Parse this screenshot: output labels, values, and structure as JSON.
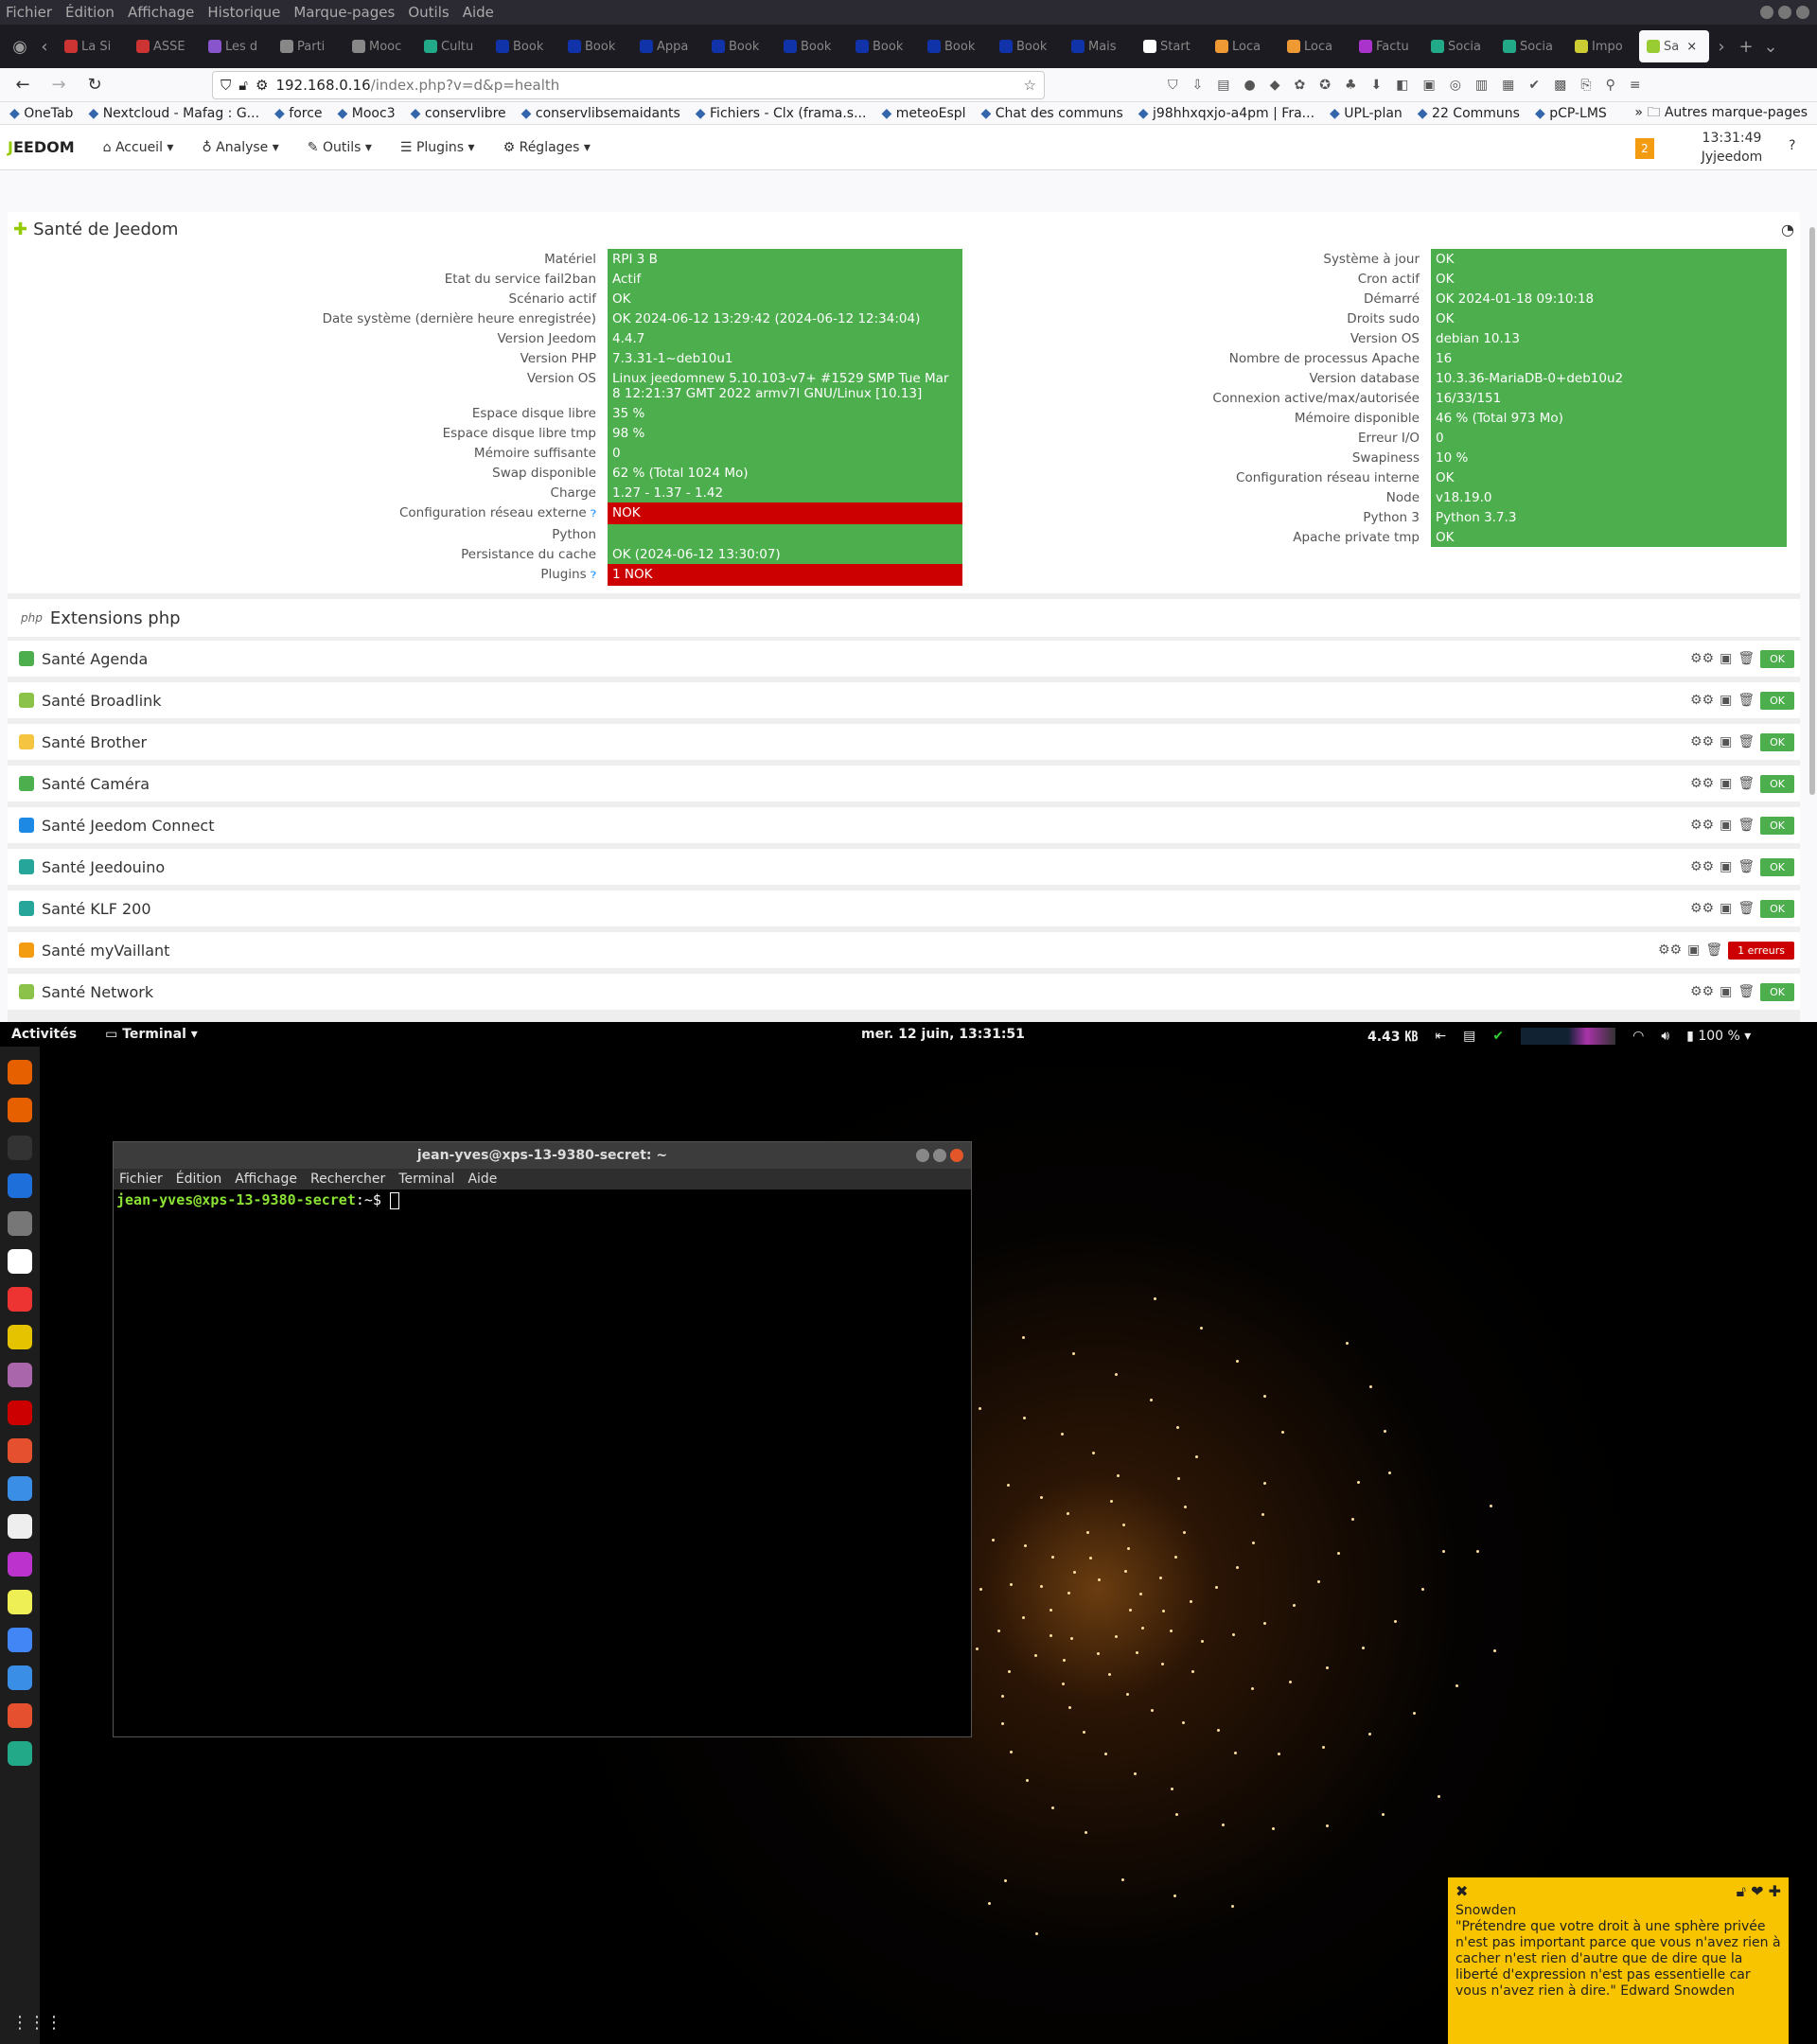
{
  "firefox": {
    "menu": [
      "Fichier",
      "Édition",
      "Affichage",
      "Historique",
      "Marque-pages",
      "Outils",
      "Aide"
    ],
    "tabs": [
      "La Si",
      "ASSE",
      "Les d",
      "Parti",
      "Mooc",
      "Cultu",
      "Book",
      "Book",
      "Appa",
      "Book",
      "Book",
      "Book",
      "Book",
      "Book",
      "Mais",
      "Start",
      "Loca",
      "Loca",
      "Factu",
      "Socia",
      "Socia",
      "Impo",
      "Sa"
    ],
    "url_host": "192.168.0.16",
    "url_path": "/index.php?v=d&p=health",
    "bookmarks": [
      "OneTab",
      "Nextcloud - Mafag : G...",
      "force",
      "Mooc3",
      "conservlibre",
      "conservlibsemaidants",
      "Fichiers - Clx (frama.s...",
      "meteoEspl",
      "Chat des communs",
      "j98hhxqxjo-a4pm | Fra...",
      "UPL-plan",
      "22 Communs",
      "pCP-LMS"
    ],
    "bookmarks_more": "Autres marque-pages"
  },
  "jeedom": {
    "logo_pre": "J",
    "logo_post": "EEDOM",
    "nav": [
      "Accueil",
      "Analyse",
      "Outils",
      "Plugins",
      "Réglages"
    ],
    "notif": "2",
    "time": "13:31:49",
    "user": "Jyjeedom",
    "health_title": "Santé de Jeedom",
    "left": [
      {
        "l": "Matériel",
        "v": "RPI 3 B",
        "s": "ok"
      },
      {
        "l": "Etat du service fail2ban",
        "v": "Actif",
        "s": "ok"
      },
      {
        "l": "Scénario actif",
        "v": "OK",
        "s": "ok"
      },
      {
        "l": "Date système (dernière heure enregistrée)",
        "v": "OK 2024-06-12 13:29:42 (2024-06-12 12:34:04)",
        "s": "ok"
      },
      {
        "l": "Version Jeedom",
        "v": "4.4.7",
        "s": "ok"
      },
      {
        "l": "Version PHP",
        "v": "7.3.31-1~deb10u1",
        "s": "ok"
      },
      {
        "l": "Version OS",
        "v": "Linux jeedomnew 5.10.103-v7+ #1529 SMP Tue Mar 8 12:21:37 GMT 2022 armv7l GNU/Linux [10.13]",
        "s": "ok"
      },
      {
        "l": "Espace disque libre",
        "v": "35 %",
        "s": "ok"
      },
      {
        "l": "Espace disque libre tmp",
        "v": "98 %",
        "s": "ok"
      },
      {
        "l": "Mémoire suffisante",
        "v": "0",
        "s": "ok"
      },
      {
        "l": "Swap disponible",
        "v": "62 % (Total 1024 Mo)",
        "s": "ok"
      },
      {
        "l": "Charge",
        "v": "1.27 - 1.37 - 1.42",
        "s": "ok"
      },
      {
        "l": "Configuration réseau externe",
        "v": "NOK",
        "s": "nok"
      },
      {
        "l": "Python",
        "v": "",
        "s": "ok"
      },
      {
        "l": "Persistance du cache",
        "v": "OK (2024-06-12 13:30:07)",
        "s": "ok"
      },
      {
        "l": "Plugins",
        "v": "1 NOK",
        "s": "nok"
      }
    ],
    "right": [
      {
        "l": "Système à jour",
        "v": "OK"
      },
      {
        "l": "Cron actif",
        "v": "OK"
      },
      {
        "l": "Démarré",
        "v": "OK 2024-01-18 09:10:18"
      },
      {
        "l": "Droits sudo",
        "v": "OK"
      },
      {
        "l": "Version OS",
        "v": "debian 10.13"
      },
      {
        "l": "Nombre de processus Apache",
        "v": "16"
      },
      {
        "l": "Version database",
        "v": "10.3.36-MariaDB-0+deb10u2"
      },
      {
        "l": "Connexion active/max/autorisée",
        "v": "16/33/151"
      },
      {
        "l": "Mémoire disponible",
        "v": "46 % (Total 973 Mo)"
      },
      {
        "l": "Erreur I/O",
        "v": "0"
      },
      {
        "l": "Swapiness",
        "v": "10 %"
      },
      {
        "l": "Configuration réseau interne",
        "v": "OK"
      },
      {
        "l": "Node",
        "v": "v18.19.0"
      },
      {
        "l": "Python 3",
        "v": "Python 3.7.3"
      },
      {
        "l": "Apache private tmp",
        "v": "OK"
      }
    ],
    "php_title": "Extensions php",
    "plugins": [
      {
        "n": "Santé Agenda",
        "st": "OK",
        "c": "#4cae4c"
      },
      {
        "n": "Santé Broadlink",
        "st": "OK",
        "c": "#8bc34a"
      },
      {
        "n": "Santé Brother",
        "st": "OK",
        "c": "#f5c542"
      },
      {
        "n": "Santé Caméra",
        "st": "OK",
        "c": "#4cae4c"
      },
      {
        "n": "Santé Jeedom Connect",
        "st": "OK",
        "c": "#1e88e5"
      },
      {
        "n": "Santé Jeedouino",
        "st": "OK",
        "c": "#26a69a"
      },
      {
        "n": "Santé KLF 200",
        "st": "OK",
        "c": "#26a69a"
      },
      {
        "n": "Santé myVaillant",
        "st": "1 erreurs",
        "c": "#f39c12"
      },
      {
        "n": "Santé Network",
        "st": "OK",
        "c": "#8bc34a"
      }
    ]
  },
  "gnome": {
    "activities": "Activités",
    "app": "Terminal",
    "clock": "mer. 12 juin, 13:31:51",
    "net": "4.43 ㎅",
    "battery": "100 %"
  },
  "terminal": {
    "title": "jean-yves@xps-13-9380-secret: ~",
    "menu": [
      "Fichier",
      "Édition",
      "Affichage",
      "Rechercher",
      "Terminal",
      "Aide"
    ],
    "prompt_user": "jean-yves@xps-13-9380-secret",
    "prompt_rest": ":~$ "
  },
  "note": {
    "title": "Snowden",
    "text": "\"Prétendre que votre droit à une sphère privée n'est pas important parce que vous n'avez rien à cacher n'est rien d'autre que de dire que la liberté d'expression n'est pas essentielle car vous n'avez rien à dire.\" Edward Snowden"
  }
}
